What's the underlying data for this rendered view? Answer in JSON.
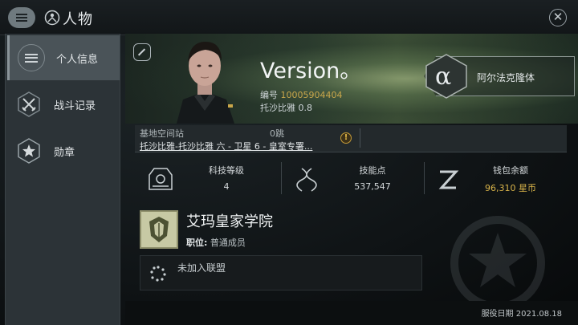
{
  "header": {
    "title": "人物",
    "menu_icon": "menu-icon",
    "close_icon": "close-icon",
    "character_icon": "character-icon"
  },
  "sidebar": {
    "items": [
      {
        "label": "个人信息",
        "icon": "list-icon",
        "active": true
      },
      {
        "label": "战斗记录",
        "icon": "crossed-swords-icon",
        "active": false
      },
      {
        "label": "勋章",
        "icon": "star-hex-icon",
        "active": false
      }
    ]
  },
  "profile": {
    "name": "Version。",
    "id_label": "编号",
    "id_value": "10005904404",
    "security": "托沙比雅 0.8",
    "alliance_symbol": "α",
    "alliance_name": "阿尔法克隆体"
  },
  "station": {
    "label": "基地空间站",
    "jumps": "0跳",
    "name": "托沙比雅-托沙比雅 六 - 卫星 6 - 皇室专署...",
    "warning": "!"
  },
  "stats": [
    {
      "label": "科技等级",
      "value": "4",
      "icon": "tech-level-icon"
    },
    {
      "label": "技能点",
      "value": "537,547",
      "icon": "skill-dna-icon"
    },
    {
      "label": "钱包余额",
      "value": "96,310 星币",
      "icon": "wallet-z-icon"
    }
  ],
  "corporation": {
    "name": "艾玛皇家学院",
    "role_label": "职位:",
    "role_value": "普通成员",
    "alliance_status": "未加入联盟"
  },
  "footer": {
    "service_date": "服役日期 2021.08.18"
  },
  "colors": {
    "accent_gold": "#d9b44a",
    "id_gold": "#c8a64b",
    "active_tab": "#4a5358"
  }
}
